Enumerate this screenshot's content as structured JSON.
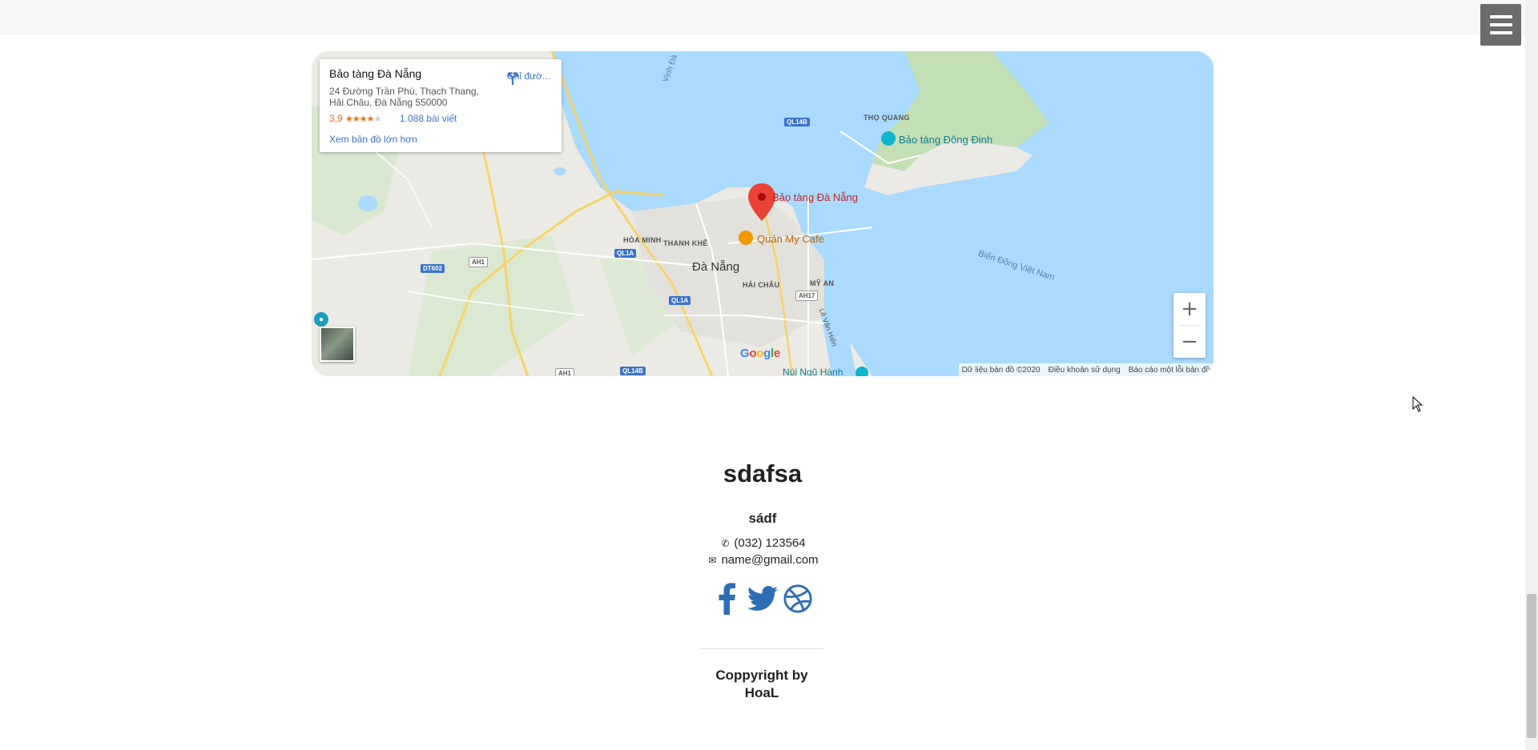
{
  "header": {
    "menu_icon": "hamburger-menu-icon"
  },
  "map": {
    "place_card": {
      "title": "Bảo tàng Đà Nẵng",
      "address": "24 Đường Trần Phú, Thạch Thang, Hải Châu, Đà Nẵng 550000",
      "rating": "3,9",
      "stars": 3.9,
      "reviews": "1.088 bài viết",
      "larger_map": "Xem bản đồ lớn hơn",
      "directions": "Chỉ đườ..."
    },
    "labels": {
      "main_pin": "Bảo tàng Đà Nẵng",
      "cafe": "Quán My Cafe",
      "museum2": "Bảo tàng Đông Đinh",
      "city": "Đà Nẵng",
      "hai_chau": "HẢI CHÂU",
      "hoa_minh": "HÒA MINH",
      "thanh_khe": "THANH KHÊ",
      "my_an": "MỸ AN",
      "tho_quang": "THỌ QUANG",
      "bay": "Vịnh Đà",
      "sea": "Biển Đông Việt Nam",
      "le_van_hien": "Lê Văn Hiến",
      "nui_ngu_hanh": "Núi Ngũ Hành",
      "google": "Google"
    },
    "roads": {
      "ql14b_top": "QL14B",
      "ql1a_a": "QL1A",
      "ql1a_b": "QL1A",
      "dt602": "DT602",
      "ah1_a": "AH1",
      "ah1_b": "AH1",
      "ah17": "AH17",
      "ql14b_bottom": "QL14B"
    },
    "controls": {
      "zoom_in": "+",
      "zoom_out": "−"
    },
    "attribution": {
      "data": "Dữ liệu bản đồ ©2020",
      "terms": "Điều khoản sử dụng",
      "report": "Báo cáo một lỗi bản đồ"
    }
  },
  "footer": {
    "title": "sdafsa",
    "subtitle": "sádf",
    "phone": "(032) 123564",
    "email": "name@gmail.com",
    "socials": [
      "facebook-icon",
      "twitter-icon",
      "dribbble-icon"
    ],
    "copyright": "Coppyright by HoaL",
    "accent": "#2d6db5"
  }
}
